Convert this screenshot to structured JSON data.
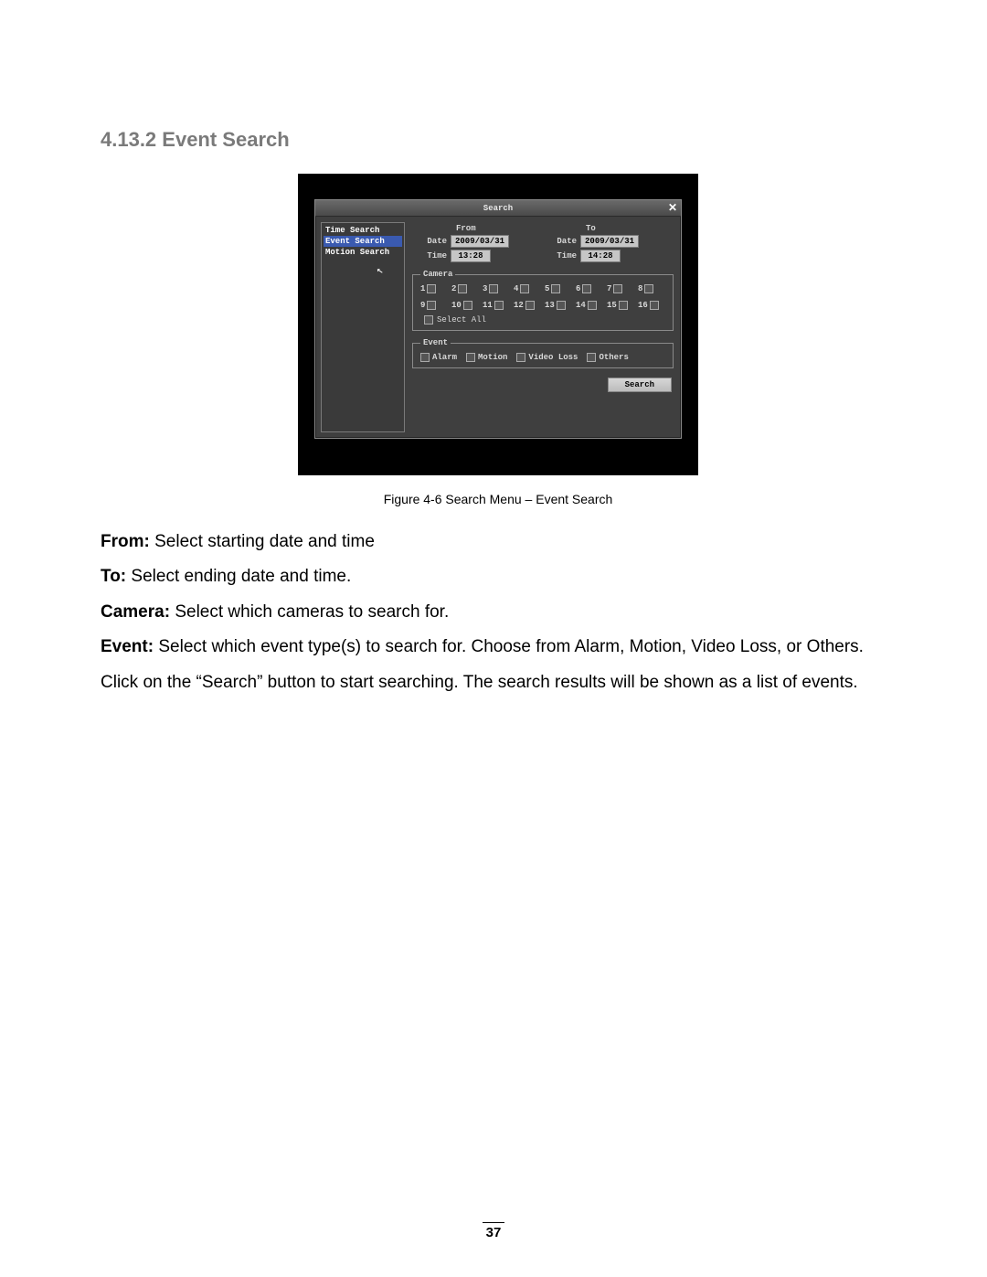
{
  "heading": "4.13.2 Event Search",
  "caption": "Figure 4-6 Search Menu – Event Search",
  "page_number": "37",
  "body": {
    "p1_label": "From:",
    "p1_text": " Select starting date and time",
    "p2_label": "To:",
    "p2_text": " Select ending date and time.",
    "p3_label": "Camera:",
    "p3_text": " Select which cameras to search for.",
    "p4_label": "Event:",
    "p4_text": " Select which event type(s) to search for. Choose from Alarm, Motion, Video Loss, or Others.",
    "p5_text": "Click on the “Search” button to start searching. The search results will be shown as a list of events."
  },
  "window": {
    "title": "Search",
    "close": "✕",
    "sidebar": {
      "items": [
        "Time Search",
        "Event Search",
        "Motion Search"
      ],
      "selected_index": 1
    },
    "from": {
      "head": "From",
      "date_label": "Date",
      "date_value": "2009/03/31",
      "time_label": "Time",
      "time_value": "13:28"
    },
    "to": {
      "head": "To",
      "date_label": "Date",
      "date_value": "2009/03/31",
      "time_label": "Time",
      "time_value": "14:28"
    },
    "camera": {
      "legend": "Camera",
      "labels": [
        "1",
        "2",
        "3",
        "4",
        "5",
        "6",
        "7",
        "8",
        "9",
        "10",
        "11",
        "12",
        "13",
        "14",
        "15",
        "16"
      ],
      "select_all": "Select All"
    },
    "event": {
      "legend": "Event",
      "items": [
        "Alarm",
        "Motion",
        "Video Loss",
        "Others"
      ]
    },
    "search_button": "Search"
  }
}
